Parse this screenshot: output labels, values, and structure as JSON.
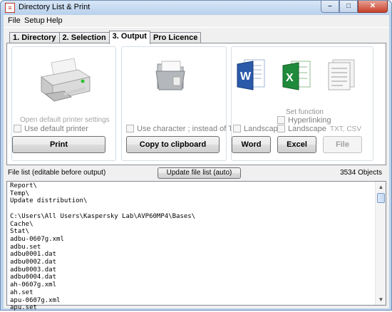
{
  "window": {
    "title": "Directory List & Print"
  },
  "menu": [
    "File",
    "Setup",
    "Help"
  ],
  "tabs": [
    "1. Directory",
    "2. Selection",
    "3. Output",
    "Pro Licence"
  ],
  "printer_group": {
    "faded_label": "Open default printer settings",
    "checkbox": "Use default printer",
    "button": "Print"
  },
  "clipboard_group": {
    "checkbox": "Use character  ;  instead of TAB",
    "button": "Copy to clipboard"
  },
  "office_group": {
    "set_function": "Set function",
    "hyperlinking": "Hyperlinking",
    "landscape_word": "Landscape",
    "landscape_excel": "Landscape",
    "txt_csv": "TXT, CSV",
    "word_button": "Word",
    "excel_button": "Excel",
    "file_button": "File"
  },
  "status": {
    "file_list_label": "File list (editable before output)",
    "update_button": "Update file list (auto)",
    "objects": "3534 Objects"
  },
  "file_lines": [
    "Report\\",
    "Temp\\",
    "Update distribution\\",
    "",
    "C:\\Users\\All Users\\Kaspersky Lab\\AVP60MP4\\Bases\\",
    "Cache\\",
    "Stat\\",
    "adbu-0607g.xml",
    "adbu.set",
    "adbu0001.dat",
    "adbu0002.dat",
    "adbu0003.dat",
    "adbu0004.dat",
    "ah-0607g.xml",
    "ah.set",
    "apu-0607g.xml",
    "apu.set"
  ],
  "icons": {
    "app": "app-icon",
    "printer": "printer-icon",
    "folder": "folder-icon",
    "word": "word-icon",
    "excel": "excel-icon",
    "text_file": "text-file-icon"
  }
}
